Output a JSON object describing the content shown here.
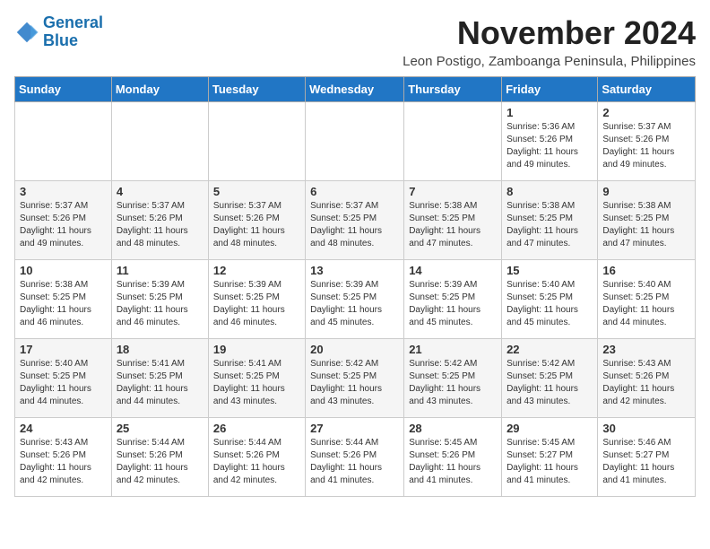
{
  "logo": {
    "line1": "General",
    "line2": "Blue"
  },
  "title": "November 2024",
  "location": "Leon Postigo, Zamboanga Peninsula, Philippines",
  "days_of_week": [
    "Sunday",
    "Monday",
    "Tuesday",
    "Wednesday",
    "Thursday",
    "Friday",
    "Saturday"
  ],
  "weeks": [
    [
      {
        "day": "",
        "info": ""
      },
      {
        "day": "",
        "info": ""
      },
      {
        "day": "",
        "info": ""
      },
      {
        "day": "",
        "info": ""
      },
      {
        "day": "",
        "info": ""
      },
      {
        "day": "1",
        "info": "Sunrise: 5:36 AM\nSunset: 5:26 PM\nDaylight: 11 hours and 49 minutes."
      },
      {
        "day": "2",
        "info": "Sunrise: 5:37 AM\nSunset: 5:26 PM\nDaylight: 11 hours and 49 minutes."
      }
    ],
    [
      {
        "day": "3",
        "info": "Sunrise: 5:37 AM\nSunset: 5:26 PM\nDaylight: 11 hours and 49 minutes."
      },
      {
        "day": "4",
        "info": "Sunrise: 5:37 AM\nSunset: 5:26 PM\nDaylight: 11 hours and 48 minutes."
      },
      {
        "day": "5",
        "info": "Sunrise: 5:37 AM\nSunset: 5:26 PM\nDaylight: 11 hours and 48 minutes."
      },
      {
        "day": "6",
        "info": "Sunrise: 5:37 AM\nSunset: 5:25 PM\nDaylight: 11 hours and 48 minutes."
      },
      {
        "day": "7",
        "info": "Sunrise: 5:38 AM\nSunset: 5:25 PM\nDaylight: 11 hours and 47 minutes."
      },
      {
        "day": "8",
        "info": "Sunrise: 5:38 AM\nSunset: 5:25 PM\nDaylight: 11 hours and 47 minutes."
      },
      {
        "day": "9",
        "info": "Sunrise: 5:38 AM\nSunset: 5:25 PM\nDaylight: 11 hours and 47 minutes."
      }
    ],
    [
      {
        "day": "10",
        "info": "Sunrise: 5:38 AM\nSunset: 5:25 PM\nDaylight: 11 hours and 46 minutes."
      },
      {
        "day": "11",
        "info": "Sunrise: 5:39 AM\nSunset: 5:25 PM\nDaylight: 11 hours and 46 minutes."
      },
      {
        "day": "12",
        "info": "Sunrise: 5:39 AM\nSunset: 5:25 PM\nDaylight: 11 hours and 46 minutes."
      },
      {
        "day": "13",
        "info": "Sunrise: 5:39 AM\nSunset: 5:25 PM\nDaylight: 11 hours and 45 minutes."
      },
      {
        "day": "14",
        "info": "Sunrise: 5:39 AM\nSunset: 5:25 PM\nDaylight: 11 hours and 45 minutes."
      },
      {
        "day": "15",
        "info": "Sunrise: 5:40 AM\nSunset: 5:25 PM\nDaylight: 11 hours and 45 minutes."
      },
      {
        "day": "16",
        "info": "Sunrise: 5:40 AM\nSunset: 5:25 PM\nDaylight: 11 hours and 44 minutes."
      }
    ],
    [
      {
        "day": "17",
        "info": "Sunrise: 5:40 AM\nSunset: 5:25 PM\nDaylight: 11 hours and 44 minutes."
      },
      {
        "day": "18",
        "info": "Sunrise: 5:41 AM\nSunset: 5:25 PM\nDaylight: 11 hours and 44 minutes."
      },
      {
        "day": "19",
        "info": "Sunrise: 5:41 AM\nSunset: 5:25 PM\nDaylight: 11 hours and 43 minutes."
      },
      {
        "day": "20",
        "info": "Sunrise: 5:42 AM\nSunset: 5:25 PM\nDaylight: 11 hours and 43 minutes."
      },
      {
        "day": "21",
        "info": "Sunrise: 5:42 AM\nSunset: 5:25 PM\nDaylight: 11 hours and 43 minutes."
      },
      {
        "day": "22",
        "info": "Sunrise: 5:42 AM\nSunset: 5:25 PM\nDaylight: 11 hours and 43 minutes."
      },
      {
        "day": "23",
        "info": "Sunrise: 5:43 AM\nSunset: 5:26 PM\nDaylight: 11 hours and 42 minutes."
      }
    ],
    [
      {
        "day": "24",
        "info": "Sunrise: 5:43 AM\nSunset: 5:26 PM\nDaylight: 11 hours and 42 minutes."
      },
      {
        "day": "25",
        "info": "Sunrise: 5:44 AM\nSunset: 5:26 PM\nDaylight: 11 hours and 42 minutes."
      },
      {
        "day": "26",
        "info": "Sunrise: 5:44 AM\nSunset: 5:26 PM\nDaylight: 11 hours and 42 minutes."
      },
      {
        "day": "27",
        "info": "Sunrise: 5:44 AM\nSunset: 5:26 PM\nDaylight: 11 hours and 41 minutes."
      },
      {
        "day": "28",
        "info": "Sunrise: 5:45 AM\nSunset: 5:26 PM\nDaylight: 11 hours and 41 minutes."
      },
      {
        "day": "29",
        "info": "Sunrise: 5:45 AM\nSunset: 5:27 PM\nDaylight: 11 hours and 41 minutes."
      },
      {
        "day": "30",
        "info": "Sunrise: 5:46 AM\nSunset: 5:27 PM\nDaylight: 11 hours and 41 minutes."
      }
    ]
  ]
}
